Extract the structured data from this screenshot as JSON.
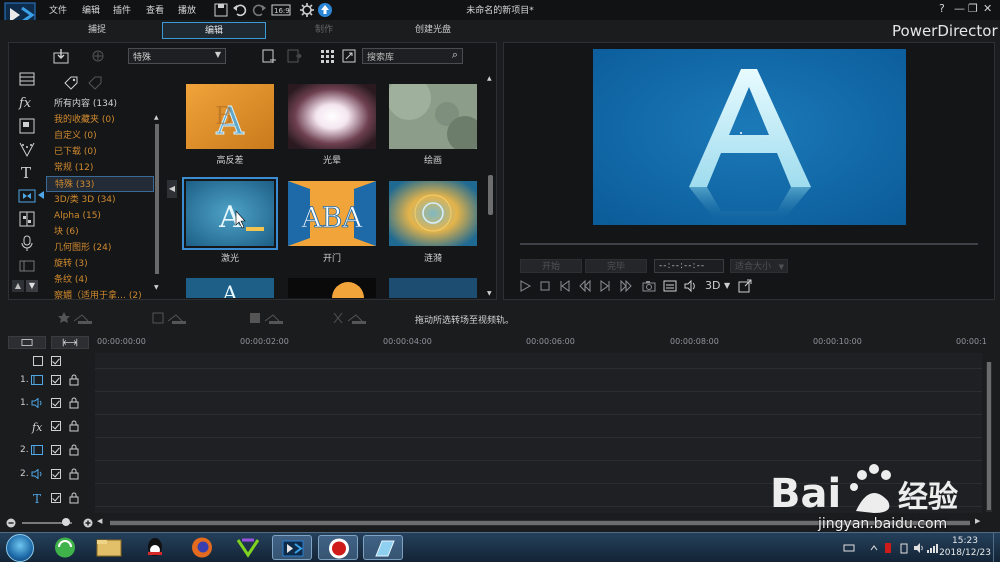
{
  "menu": {
    "items": [
      "文件",
      "编辑",
      "插件",
      "查看",
      "播放"
    ],
    "window_title": "未命名的新项目*",
    "help": "?",
    "minimize": "—",
    "restore": "❐",
    "close": "✕"
  },
  "mode_tabs": [
    {
      "label": "捕捉",
      "state": "normal"
    },
    {
      "label": "编辑",
      "state": "active"
    },
    {
      "label": "制作",
      "state": "disabled"
    },
    {
      "label": "创建光盘",
      "state": "normal"
    }
  ],
  "brand": "PowerDirector",
  "library": {
    "category_select": "特殊",
    "search_placeholder": "搜索库",
    "categories": [
      {
        "label": "所有内容 (134)"
      },
      {
        "label": "我的收藏夹  (0)"
      },
      {
        "label": "自定义  (0)"
      },
      {
        "label": "已下载  (0)"
      },
      {
        "label": "常规  (12)"
      },
      {
        "label": "特殊  (33)",
        "selected": true
      },
      {
        "label": "3D/类 3D  (34)"
      },
      {
        "label": "Alpha  (15)"
      },
      {
        "label": "块  (6)"
      },
      {
        "label": "几何图形  (24)"
      },
      {
        "label": "旋转  (3)"
      },
      {
        "label": "条纹  (4)"
      },
      {
        "label": "察媚（适用于拿…  (2)"
      }
    ],
    "transitions": [
      {
        "label": "高反差"
      },
      {
        "label": "光晕"
      },
      {
        "label": "绘画"
      },
      {
        "label": "激光",
        "selected": true
      },
      {
        "label": "开门"
      },
      {
        "label": "涟漪"
      }
    ]
  },
  "preview": {
    "btn_start": "开始",
    "btn_end": "完毕",
    "timecode": "--:--:--:--",
    "fit_label": "适合大小",
    "three_d": "3D"
  },
  "edit_toolbar": {
    "hint": "拖动所选转场至视频轨。"
  },
  "timeline": {
    "ruler": [
      "00:00:00:00",
      "00:00:02:00",
      "00:00:04:00",
      "00:00:06:00",
      "00:00:08:00",
      "00:00:10:00",
      "00:00:1"
    ],
    "tracks": [
      {
        "num": "",
        "type": "master"
      },
      {
        "num": "1.",
        "type": "video"
      },
      {
        "num": "1.",
        "type": "audio"
      },
      {
        "num": "",
        "type": "fx"
      },
      {
        "num": "2.",
        "type": "video"
      },
      {
        "num": "2.",
        "type": "audio"
      },
      {
        "num": "",
        "type": "title"
      }
    ]
  },
  "taskbar": {
    "time": "15:23",
    "date": "2018/12/23"
  },
  "watermark": {
    "url": "jingyan.baidu.com"
  },
  "colors": {
    "accent": "#3a9ad9",
    "category_text": "#d08a2e",
    "preview_bg": "#0b5d9a"
  }
}
